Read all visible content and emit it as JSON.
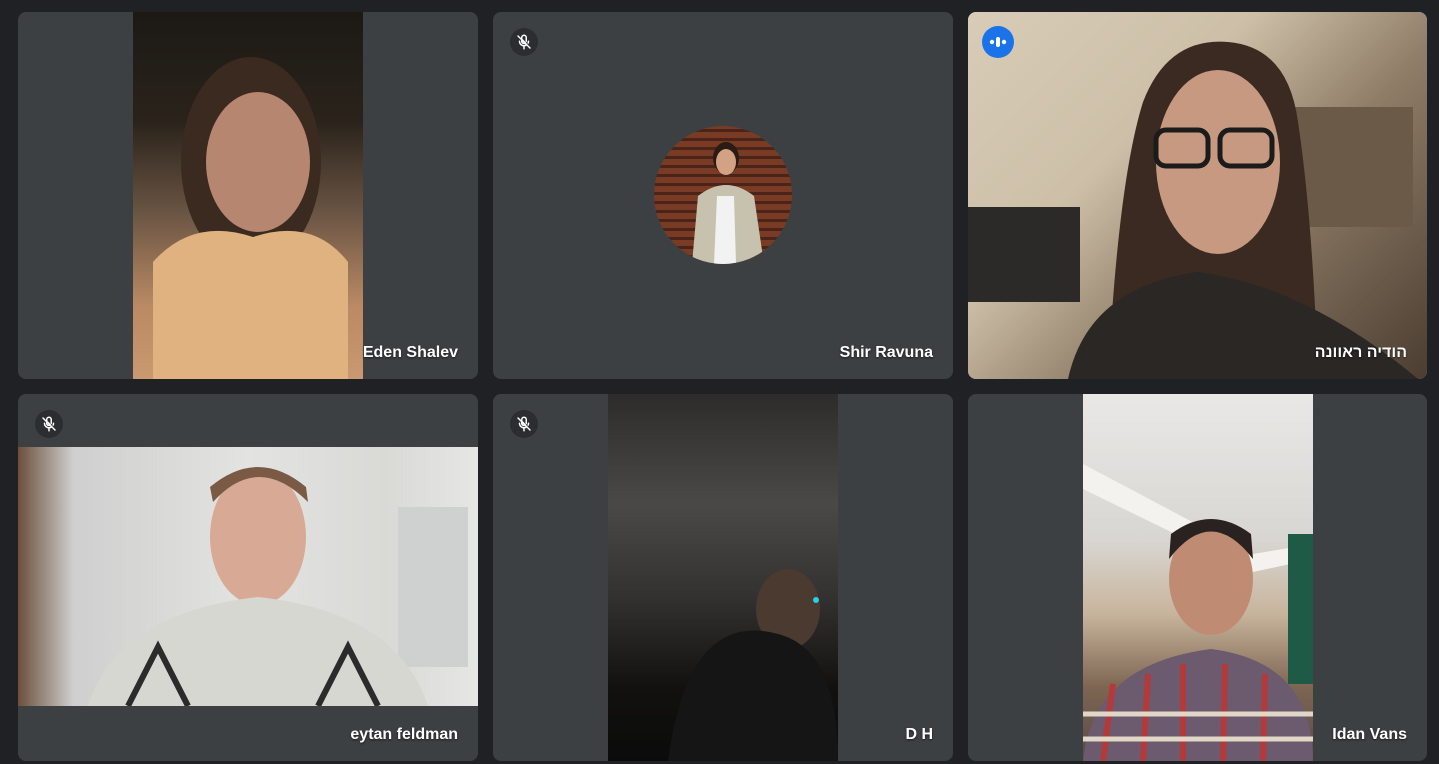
{
  "participants": [
    {
      "name": "Eden Shalev",
      "muted": false,
      "speaking": false,
      "camera_on": true
    },
    {
      "name": "Shir Ravuna",
      "muted": true,
      "speaking": false,
      "camera_on": false
    },
    {
      "name": "הודיה ראוונה",
      "muted": false,
      "speaking": true,
      "camera_on": true
    },
    {
      "name": "eytan feldman",
      "muted": true,
      "speaking": false,
      "camera_on": true
    },
    {
      "name": "D H",
      "muted": true,
      "speaking": false,
      "camera_on": true
    },
    {
      "name": "Idan Vans",
      "muted": false,
      "speaking": false,
      "camera_on": true
    }
  ],
  "icons": {
    "mic_off": "mic-off-icon",
    "speaking": "audio-level-icon"
  },
  "colors": {
    "background": "#202124",
    "tile": "#3c4043",
    "active_border": "#8ab4f8",
    "speaking_badge": "#1a73e8"
  }
}
